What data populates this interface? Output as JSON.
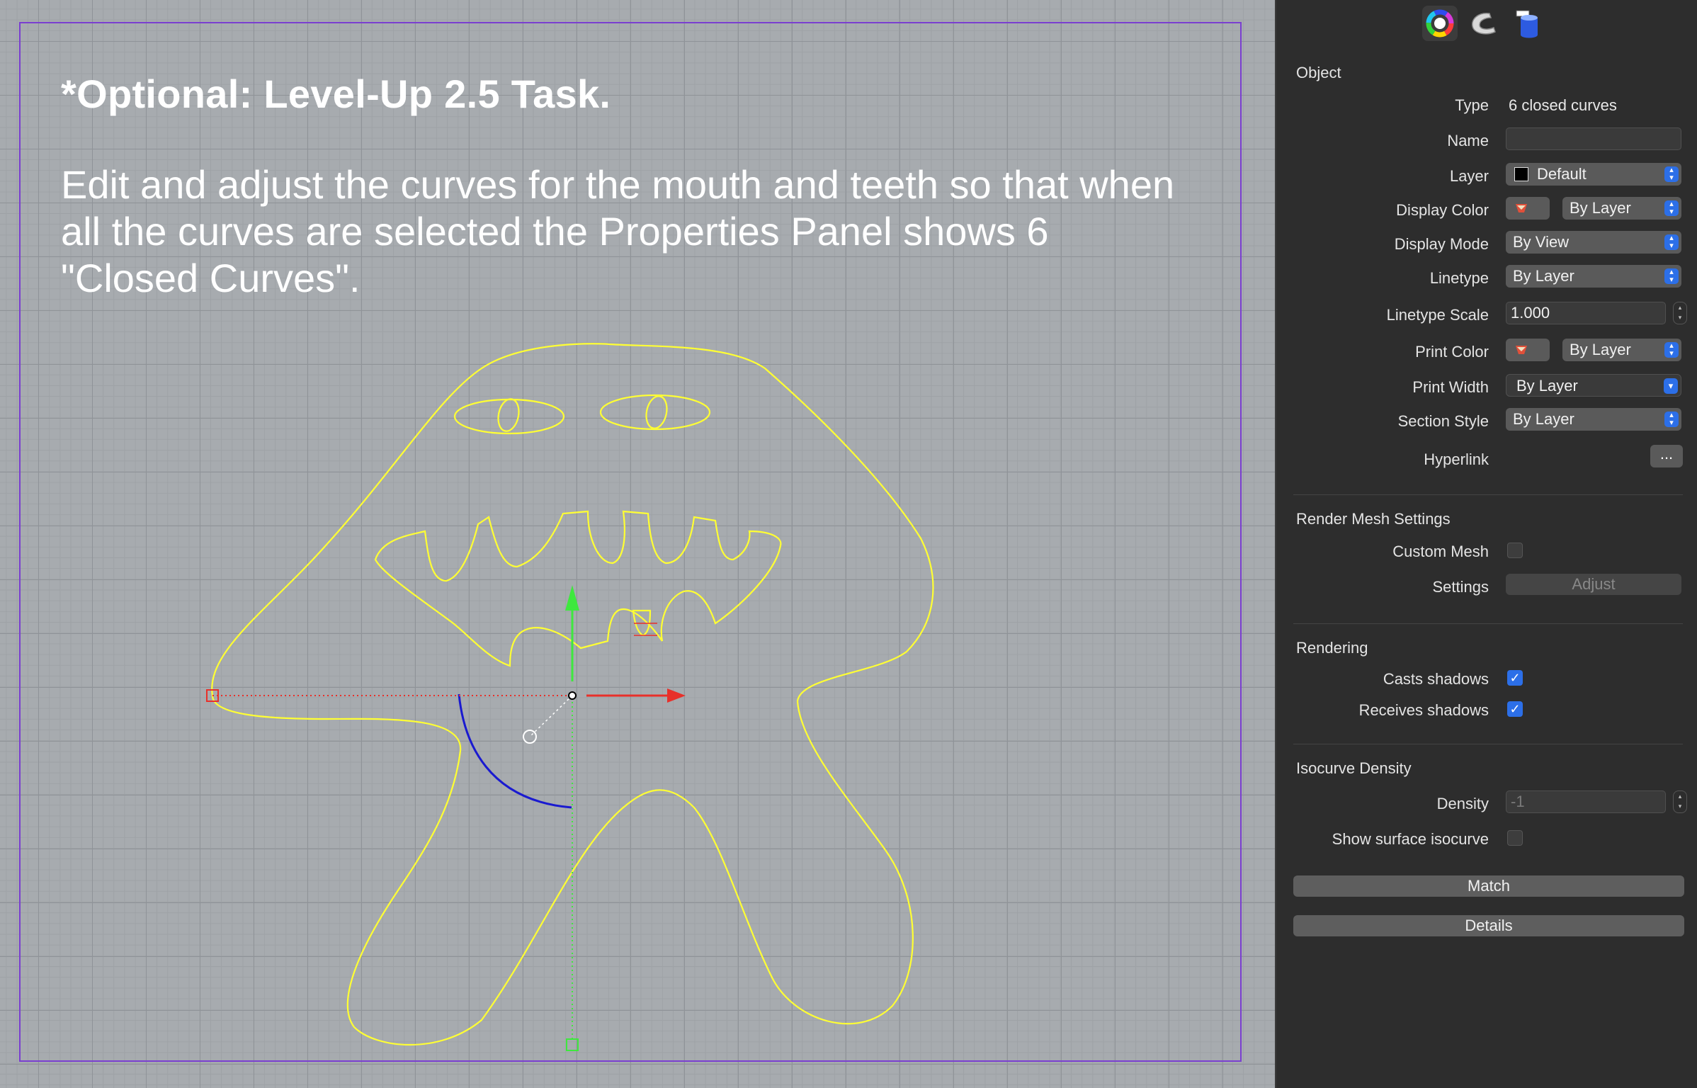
{
  "viewport": {
    "title": "*Optional: Level-Up 2.5 Task.",
    "body_lines": [
      "Edit and adjust the curves for the mouth and teeth so that when",
      "all the curves are selected the Properties Panel shows 6",
      "\"Closed Curves\"."
    ],
    "colors": {
      "curve": "#ffff33",
      "selected_curve": "#1a1ad0",
      "frame": "#7a3fd0",
      "x_axis": "#e8302a",
      "y_axis": "#3ee83e"
    }
  },
  "panel": {
    "tabs": [
      {
        "icon": "color-wheel-icon"
      },
      {
        "icon": "material-icon"
      },
      {
        "icon": "object-cylinder-icon"
      }
    ],
    "object_section": "Object",
    "type_label": "Type",
    "type_value": "6 closed curves",
    "name_label": "Name",
    "name_value": "",
    "layer_label": "Layer",
    "layer_value": "Default",
    "display_color_label": "Display Color",
    "display_color_value": "By Layer",
    "display_mode_label": "Display Mode",
    "display_mode_value": "By View",
    "linetype_label": "Linetype",
    "linetype_value": "By Layer",
    "linetype_scale_label": "Linetype Scale",
    "linetype_scale_value": "1.000",
    "print_color_label": "Print Color",
    "print_color_value": "By Layer",
    "print_width_label": "Print Width",
    "print_width_value": "By Layer",
    "section_style_label": "Section Style",
    "section_style_value": "By Layer",
    "hyperlink_label": "Hyperlink",
    "hyperlink_button": "...",
    "render_mesh_section": "Render Mesh Settings",
    "custom_mesh_label": "Custom Mesh",
    "settings_label": "Settings",
    "adjust_button": "Adjust",
    "rendering_section": "Rendering",
    "casts_shadows_label": "Casts shadows",
    "receives_shadows_label": "Receives shadows",
    "isocurve_section": "Isocurve Density",
    "density_label": "Density",
    "density_value": "-1",
    "show_iso_label": "Show surface isocurve",
    "match_button": "Match",
    "details_button": "Details"
  }
}
